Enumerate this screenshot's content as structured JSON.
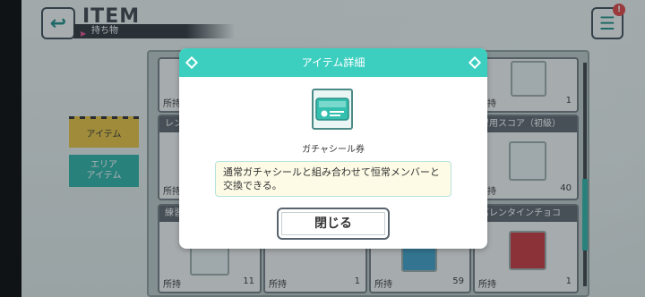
{
  "header": {
    "title": "ITEM",
    "subtitle": "持ち物",
    "menu_badge": "!"
  },
  "side_tabs": [
    {
      "label": "アイテム"
    },
    {
      "label": "エリア\nアイテム"
    }
  ],
  "background_cards": [
    {
      "title": "",
      "owned_label": "所持",
      "qty": "",
      "thumb": true
    },
    {
      "title": "",
      "owned_label": "所持",
      "qty": "1",
      "thumb": true
    },
    {
      "title": "レン",
      "owned_label": "所持",
      "qty": "",
      "thumb": false
    },
    {
      "title": "習用スコア（初級）",
      "owned_label": "所持",
      "qty": "40",
      "thumb": true
    },
    {
      "title": "練習",
      "owned_label": "所持",
      "qty": "11",
      "thumb": true
    },
    {
      "title": "",
      "owned_label": "所持",
      "qty": "1",
      "thumb": true
    },
    {
      "title": "",
      "owned_label": "所持",
      "qty": "59",
      "thumb": true
    },
    {
      "title": "バレンタインチョコ",
      "owned_label": "所持",
      "qty": "1",
      "thumb": true
    }
  ],
  "dialog": {
    "title": "アイテム詳細",
    "item_name": "ガチャシール券",
    "description": "通常ガチャシールと組み合わせて恒常メンバーと交換できる。",
    "close_label": "閉じる",
    "icon": "ticket-icon"
  },
  "colors": {
    "accent": "#3ccfc0",
    "tab_item": "#e8c23a",
    "tab_area": "#2bb2a6"
  }
}
